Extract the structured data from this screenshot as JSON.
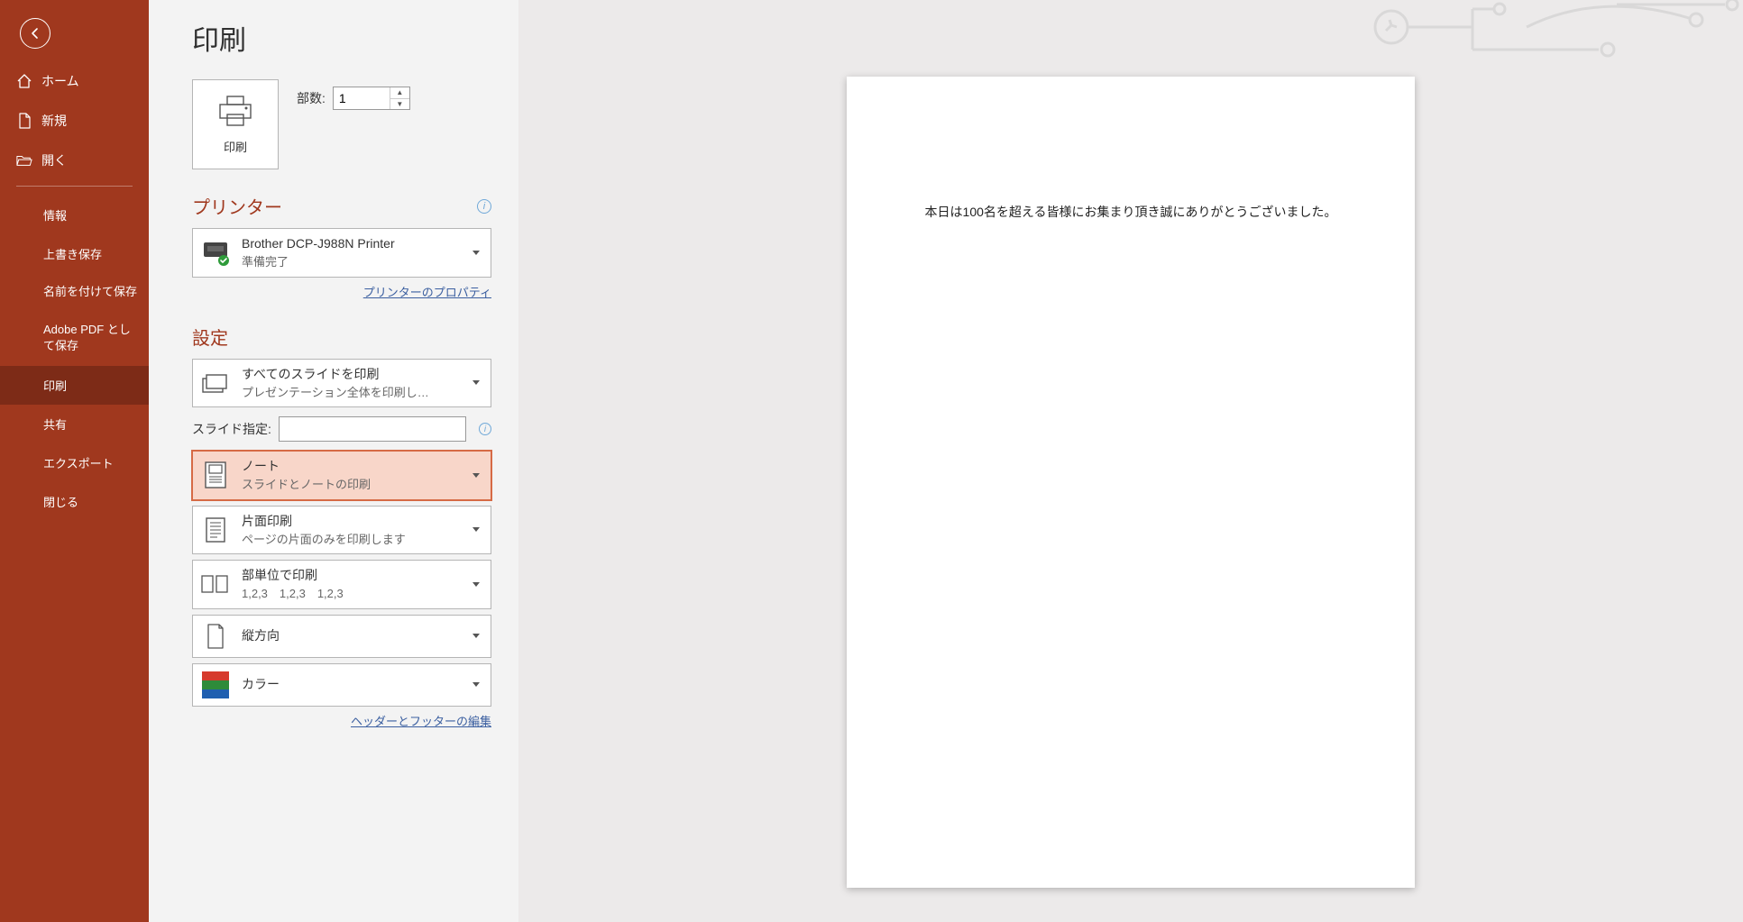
{
  "sidebar": {
    "back_label": "戻る",
    "items": [
      {
        "id": "home",
        "label": "ホーム"
      },
      {
        "id": "new",
        "label": "新規"
      },
      {
        "id": "open",
        "label": "開く"
      }
    ],
    "sub_items": [
      {
        "id": "info",
        "label": "情報"
      },
      {
        "id": "overwrite",
        "label": "上書き保存"
      },
      {
        "id": "saveas",
        "label": "名前を付けて保存"
      },
      {
        "id": "adobepdf",
        "label": "Adobe PDF として保存"
      },
      {
        "id": "print",
        "label": "印刷"
      },
      {
        "id": "share",
        "label": "共有"
      },
      {
        "id": "export",
        "label": "エクスポート"
      },
      {
        "id": "close",
        "label": "閉じる"
      }
    ],
    "active_sub": "print"
  },
  "page": {
    "title": "印刷"
  },
  "print_button": {
    "label": "印刷"
  },
  "copies": {
    "label": "部数:",
    "value": "1"
  },
  "printer": {
    "section_title": "プリンター",
    "name": "Brother DCP-J988N Printer",
    "status": "準備完了",
    "properties_link": "プリンターのプロパティ"
  },
  "settings": {
    "section_title": "設定",
    "print_range": {
      "title": "すべてのスライドを印刷",
      "sub": "プレゼンテーション全体を印刷し…"
    },
    "slides_label": "スライド指定:",
    "slides_value": "",
    "layout": {
      "title": "ノート",
      "sub": "スライドとノートの印刷"
    },
    "side": {
      "title": "片面印刷",
      "sub": "ページの片面のみを印刷します"
    },
    "collate": {
      "title": "部単位で印刷",
      "sub": "1,2,3　1,2,3　1,2,3"
    },
    "orientation": {
      "title": "縦方向"
    },
    "color": {
      "title": "カラー"
    },
    "header_footer_link": "ヘッダーとフッターの編集"
  },
  "preview": {
    "body_text": "本日は100名を超える皆様にお集まり頂き誠にありがとうございました。"
  },
  "colors": {
    "accent": "#a0381e",
    "sidebar_bg": "#a0381e",
    "active_bg": "#f8d6c9"
  }
}
